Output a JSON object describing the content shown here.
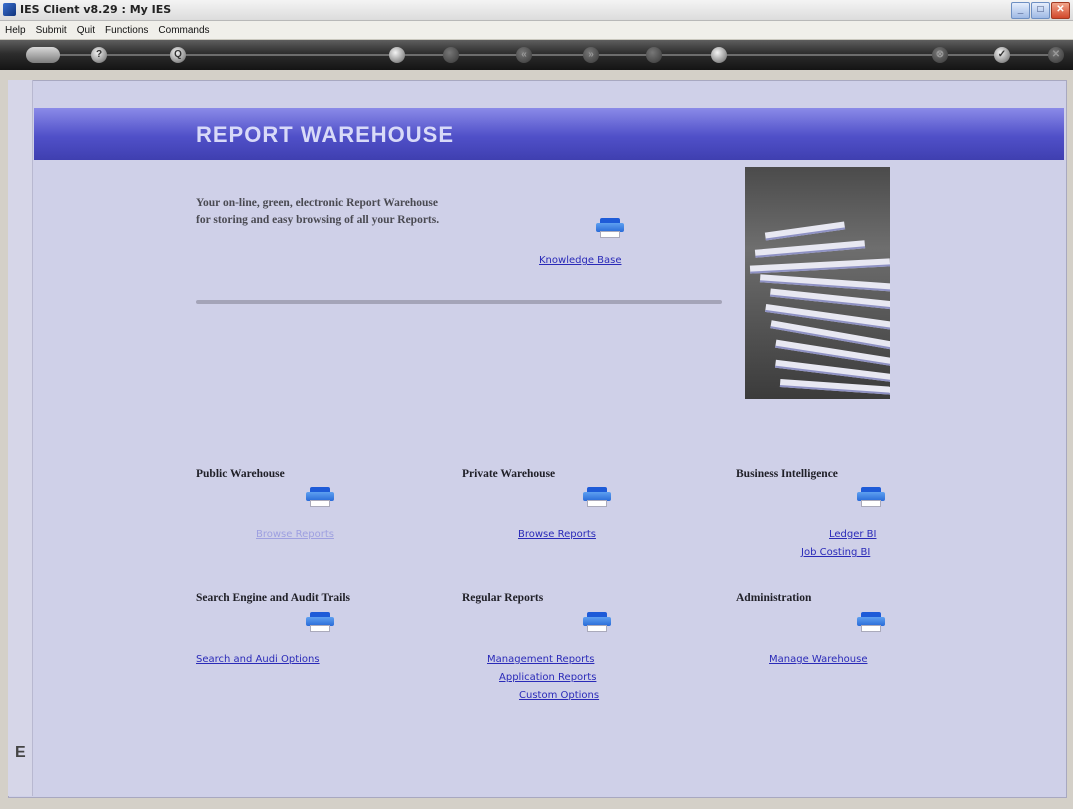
{
  "window": {
    "title": "IES Client v8.29 : My IES",
    "minimize": "_",
    "maximize": "□",
    "close": "✕"
  },
  "menu": [
    "Help",
    "Submit",
    "Quit",
    "Functions",
    "Commands"
  ],
  "toolbar": {
    "icons": [
      "key-icon",
      "help-icon",
      "search-icon",
      "heart-icon",
      "info-icon",
      "back-icon",
      "forward-icon",
      "up-icon",
      "record-icon",
      "cancel-icon",
      "ok-icon",
      "close-icon"
    ],
    "help_glyph": "?",
    "search_glyph": "Q",
    "back_glyph": "«",
    "forward_glyph": "»",
    "cancel_glyph": "⊗",
    "ok_glyph": "✓",
    "close_glyph": "✕"
  },
  "banner": {
    "title": "REPORT WAREHOUSE"
  },
  "intro": {
    "line1": "Your on-line, green, electronic Report Warehouse",
    "line2": "for storing and easy browsing of all your Reports.",
    "knowledge_link": "Knowledge Base"
  },
  "sections": {
    "public": {
      "title": "Public Warehouse",
      "links": [
        "Browse Reports"
      ]
    },
    "private": {
      "title": "Private Warehouse",
      "links": [
        "Browse Reports"
      ]
    },
    "bi": {
      "title": "Business Intelligence",
      "links": [
        "Ledger BI",
        "Job Costing BI"
      ]
    },
    "search": {
      "title": "Search Engine and Audit Trails",
      "links": [
        "Search and Audi Options"
      ]
    },
    "regular": {
      "title": "Regular Reports",
      "links": [
        "Management Reports",
        "Application Reports",
        "Custom Options"
      ]
    },
    "admin": {
      "title": "Administration",
      "links": [
        "Manage Warehouse"
      ]
    }
  },
  "rail": {
    "label": "E"
  }
}
